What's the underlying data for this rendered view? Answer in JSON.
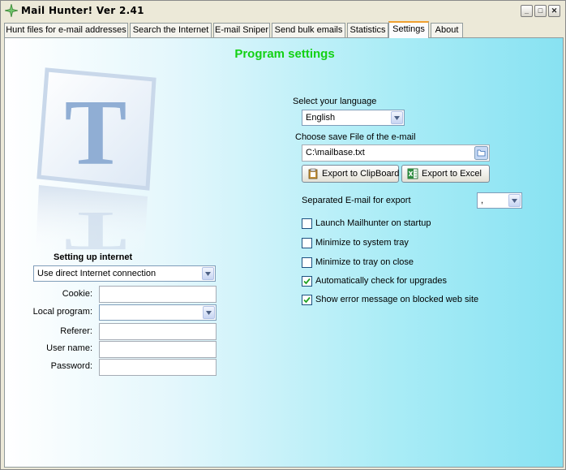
{
  "window": {
    "title": "Mail Hunter!   Ver 2.41",
    "controls": {
      "minimize": "_",
      "maximize": "□",
      "close": "✕"
    }
  },
  "tabs": [
    {
      "label": "Hunt files for e-mail addresses"
    },
    {
      "label": "Search the Internet"
    },
    {
      "label": "E-mail Sniper"
    },
    {
      "label": "Send bulk emails"
    },
    {
      "label": "Statistics"
    },
    {
      "label": "Settings",
      "active": true
    },
    {
      "label": "About"
    }
  ],
  "settings": {
    "heading": "Program settings",
    "heading_color": "#13d113",
    "language_label": "Select your language",
    "language_value": "English",
    "save_file_label": "Choose save File of the e-mail",
    "save_file_value": "C:\\mailbase.txt",
    "export_clipboard": "Export to ClipBoard",
    "export_excel": "Export to Excel",
    "separator_label": "Separated E-mail for export",
    "separator_value": ",",
    "options": [
      {
        "label": "Launch Mailhunter on startup",
        "checked": false
      },
      {
        "label": "Minimize to system tray",
        "checked": false
      },
      {
        "label": "Minimize to tray on close",
        "checked": false
      },
      {
        "label": "Automatically check for upgrades",
        "checked": true
      },
      {
        "label": "Show error message on blocked web site",
        "checked": true
      }
    ]
  },
  "internet": {
    "heading": "Setting up internet",
    "connection_value": "Use direct Internet connection",
    "cookie_label": "Cookie:",
    "cookie_value": "",
    "local_program_label": "Local program:",
    "local_program_value": "",
    "referer_label": "Referer:",
    "referer_value": "",
    "username_label": "User name:",
    "username_value": "",
    "password_label": "Password:",
    "password_value": ""
  },
  "icons": {
    "app": "sparkle-icon",
    "logo": "letter-t-logo",
    "browse": "browse-file-icon",
    "clipboard": "clipboard-icon",
    "excel": "excel-icon"
  }
}
